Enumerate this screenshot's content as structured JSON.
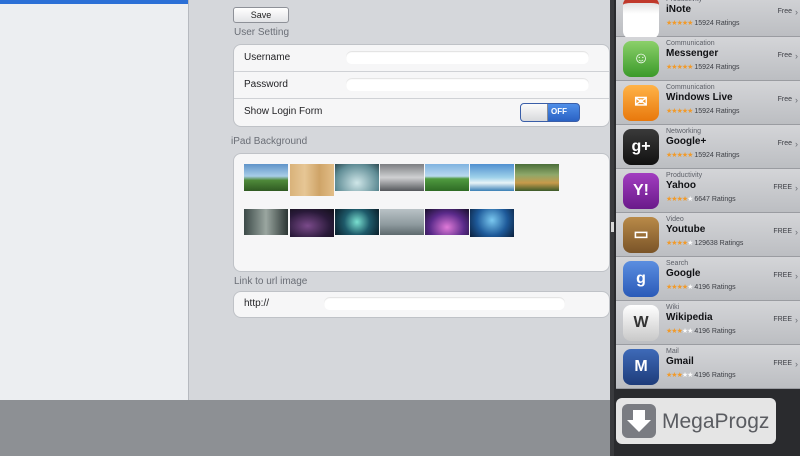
{
  "settings": {
    "save_label": "Save",
    "user_setting_label": "User Setting",
    "rows": [
      {
        "label": "Username"
      },
      {
        "label": "Password"
      },
      {
        "label": "Show Login Form"
      }
    ],
    "toggle_value": "OFF",
    "ipad_background_label": "iPad Background",
    "link_label": "Link to url image",
    "link_value": "http://"
  },
  "app_list": [
    {
      "category": "Productivity",
      "name": "iNote",
      "stars": 5,
      "ratings": "15924 Ratings",
      "price": "Free",
      "icon": "notepad-icon"
    },
    {
      "category": "Communication",
      "name": "Messenger",
      "stars": 5,
      "ratings": "15924 Ratings",
      "price": "Free",
      "icon": "messenger-icon"
    },
    {
      "category": "Communication",
      "name": "Windows Live",
      "stars": 5,
      "ratings": "15924 Ratings",
      "price": "Free",
      "icon": "mail-envelope-icon"
    },
    {
      "category": "Networking",
      "name": "Google+",
      "stars": 5,
      "ratings": "15924 Ratings",
      "price": "Free",
      "icon": "google-plus-icon"
    },
    {
      "category": "Productivity",
      "name": "Yahoo",
      "stars": 4,
      "ratings": "6647 Ratings",
      "price": "FREE",
      "icon": "yahoo-icon"
    },
    {
      "category": "Video",
      "name": "Youtube",
      "stars": 4,
      "ratings": "129638 Ratings",
      "price": "FREE",
      "icon": "youtube-tv-icon"
    },
    {
      "category": "Search",
      "name": "Google",
      "stars": 4,
      "ratings": "4196 Ratings",
      "price": "FREE",
      "icon": "google-search-icon"
    },
    {
      "category": "Wiki",
      "name": "Wikipedia",
      "stars": 3,
      "ratings": "4196 Ratings",
      "price": "FREE",
      "icon": "wikipedia-icon"
    },
    {
      "category": "Mail",
      "name": "Gmail",
      "stars": 3,
      "ratings": "4196 Ratings",
      "price": "FREE",
      "icon": "gmail-icon"
    }
  ],
  "watermark": {
    "text": "MegaProgz",
    "icon": "download-arrow-icon"
  },
  "colors": {
    "accent": "#2b6fd6",
    "star": "#f19a2a"
  }
}
